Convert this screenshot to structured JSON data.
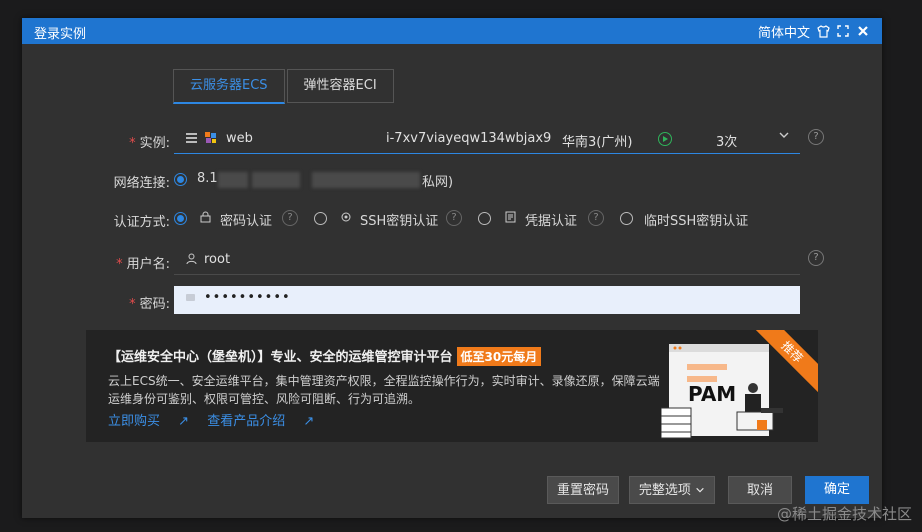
{
  "window": {
    "title": "登录实例",
    "lang": "简体中文",
    "icons": [
      "shirt-icon",
      "fullscreen-icon",
      "close-icon"
    ]
  },
  "tabs": [
    {
      "label": "云服务器ECS",
      "active": true
    },
    {
      "label": "弹性容器ECI",
      "active": false
    }
  ],
  "instance": {
    "label": "实例:",
    "name": "web",
    "id": "i-7xv7viayeqw134wbjax9",
    "region": "华南3(广州)",
    "count": "3次"
  },
  "network": {
    "label": "网络连接:",
    "ip_prefix": "8.1",
    "suffix": "私网)"
  },
  "auth": {
    "label": "认证方式:",
    "options": [
      {
        "label": "密码认证",
        "icon": "lock-icon",
        "checked": true
      },
      {
        "label": "SSH密钥认证",
        "icon": "key-icon",
        "checked": false
      },
      {
        "label": "凭据认证",
        "icon": "credential-icon",
        "checked": false
      },
      {
        "label": "临时SSH密钥认证",
        "checked": false
      }
    ]
  },
  "username": {
    "label": "用户名:",
    "value": "root"
  },
  "password": {
    "label": "密码:",
    "value": "••••••••••"
  },
  "banner": {
    "headline": "【运维安全中心（堡垒机）】专业、安全的运维管控审计平台",
    "badge": "低至30元每月",
    "desc": "云上ECS统一、安全运维平台，集中管理资产权限，全程监控操作行为，实时审计、录像还原，保障云端运维身份可鉴别、权限可管控、风险可阻断、行为可追溯。",
    "link_buy": "立即购买",
    "link_info": "查看产品介绍",
    "ribbon": "推荐",
    "illus_text": "PAM"
  },
  "buttons": {
    "reset": "重置密码",
    "options": "完整选项",
    "cancel": "取消",
    "ok": "确定"
  },
  "watermark": "@稀土掘金技术社区",
  "colors": {
    "accent": "#1f75d0",
    "required": "#e34c4c",
    "orange": "#f07a1a",
    "running": "#2fb35a"
  }
}
